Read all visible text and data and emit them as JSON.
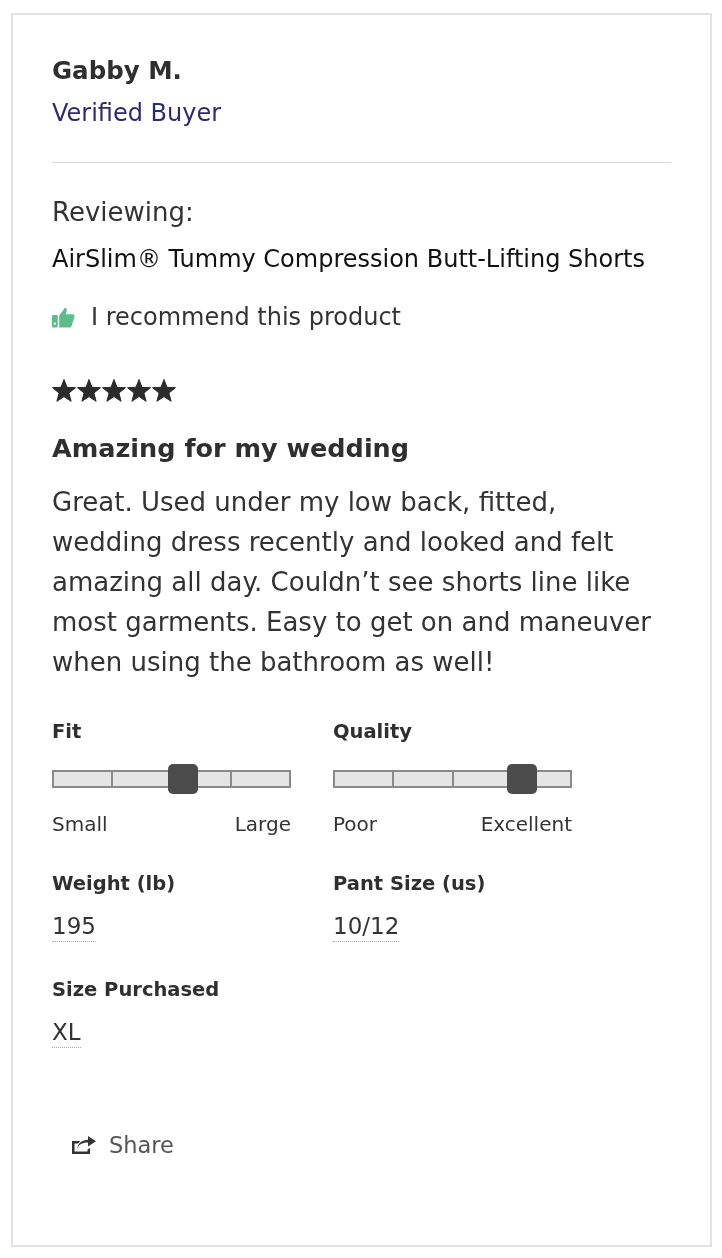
{
  "reviewer": {
    "name": "Gabby M.",
    "badge": "Verified Buyer"
  },
  "product": {
    "label": "Reviewing:",
    "name": "AirSlim® Tummy Compression Butt-Lifting Shorts"
  },
  "recommendation": {
    "text": "I recommend this product"
  },
  "rating": {
    "stars": 5
  },
  "review": {
    "title": "Amazing for my wedding",
    "body": "Great. Used under my low back, fitted, wedding dress recently and looked and felt amazing all day. Couldn’t see shorts line like most garments. Easy to get on and maneuver when using the bathroom as well!"
  },
  "sliders": [
    {
      "label": "Fit",
      "level": 0.55,
      "min_label": "Small",
      "max_label": "Large"
    },
    {
      "label": "Quality",
      "level": 0.79,
      "min_label": "Poor",
      "max_label": "Excellent"
    }
  ],
  "attributes": [
    {
      "label": "Weight (lb)",
      "value": "195"
    },
    {
      "label": "Pant Size (us)",
      "value": "10/12"
    },
    {
      "label": "Size Purchased",
      "value": "XL"
    }
  ],
  "share": {
    "label": "Share"
  }
}
